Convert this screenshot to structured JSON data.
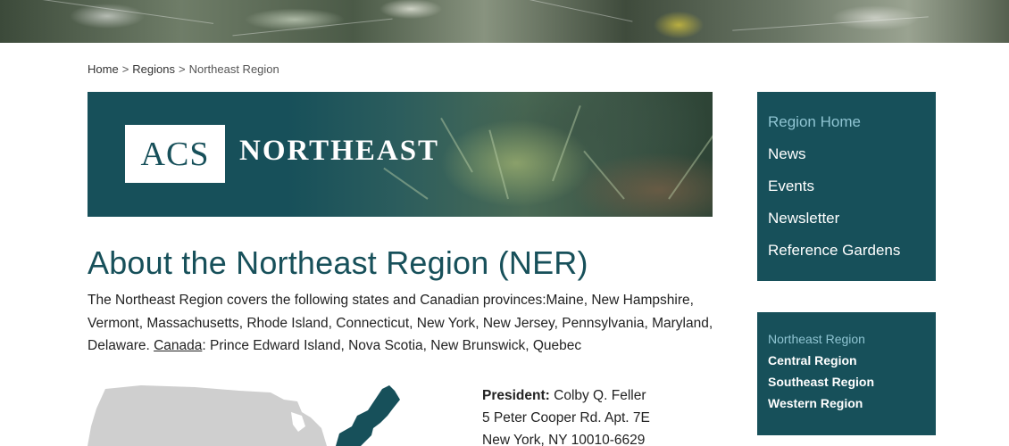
{
  "breadcrumb": {
    "items": [
      "Home",
      "Regions",
      "Northeast Region"
    ],
    "separator": ">"
  },
  "banner": {
    "logo_text": "ACS",
    "wordmark": "NORTHEAST"
  },
  "main": {
    "title": "About the Northeast Region (NER)",
    "intro_part1": "The Northeast Region covers the following states and Canadian provinces:Maine, New Hampshire, Vermont, Massachusetts, Rhode Island, Connecticut, New York, New Jersey, Pennsylvania, Maryland, Delaware. ",
    "intro_link": "Canada",
    "intro_part2": ": Prince Edward Island, Nova Scotia, New Brunswick, Quebec"
  },
  "president": {
    "label": "President:",
    "name": "Colby Q. Feller",
    "address1": "5 Peter Cooper Rd. Apt. 7E",
    "address2": "New York, NY 10010-6629"
  },
  "side_nav": {
    "items": [
      "Region Home",
      "News",
      "Events",
      "Newsletter",
      "Reference Gardens"
    ],
    "active": "Region Home"
  },
  "region_nav": {
    "items": [
      "Northeast Region",
      "Central Region",
      "Southeast Region",
      "Western Region"
    ],
    "active": "Northeast Region"
  },
  "colors": {
    "brand_teal": "#17505a",
    "active_link": "#8fc4d2",
    "map_gray": "#cfcfcf"
  }
}
